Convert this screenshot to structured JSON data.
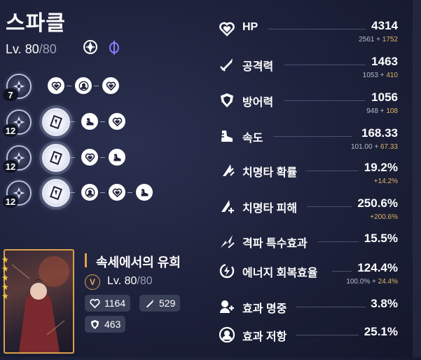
{
  "character": {
    "name": "스파클",
    "level_label": "Lv. ",
    "level": "80",
    "level_sep": "/",
    "level_max": "80",
    "path_icon": "harmony-path-icon",
    "element_icon": "quantum-element-icon"
  },
  "traces": {
    "rows": [
      {
        "badge": "7",
        "nodes": [
          "hp-heart-icon",
          "effect-res-icon",
          "hp-heart-icon"
        ]
      },
      {
        "badge": "12",
        "nodes": [
          "speed-boot-icon",
          "hp-heart-icon"
        ]
      },
      {
        "badge": "12",
        "nodes": [
          "hp-heart-icon",
          "speed-boot-icon"
        ]
      },
      {
        "badge": "12",
        "nodes": [
          "effect-res-icon",
          "hp-heart-icon",
          "speed-boot-icon"
        ]
      }
    ]
  },
  "light_cone": {
    "stars": 5,
    "name": "속세에서의 유희",
    "rank": "V",
    "level_label": "Lv. ",
    "level": "80",
    "level_sep": "/",
    "level_max": "80",
    "hp": "1164",
    "atk": "529",
    "def": "463"
  },
  "stats": [
    {
      "name": "HP",
      "icon": "hp-heart-icon",
      "value": "4314",
      "base": "2561",
      "bonus": "1752"
    },
    {
      "name": "공격력",
      "icon": "attack-sword-icon",
      "value": "1463",
      "base": "1053",
      "bonus": "410"
    },
    {
      "name": "방어력",
      "icon": "defense-shield-icon",
      "value": "1056",
      "base": "948",
      "bonus": "108"
    },
    {
      "name": "속도",
      "icon": "speed-boot-icon",
      "value": "168.33",
      "base": "101.00",
      "bonus": "67.33"
    },
    {
      "name": "치명타 확률",
      "icon": "crit-rate-icon",
      "value": "19.2%",
      "bonus_only": "+14.2%"
    },
    {
      "name": "치명타 피해",
      "icon": "crit-dmg-icon",
      "value": "250.6%",
      "bonus_only": "+200.6%"
    },
    {
      "name": "격파 특수효과",
      "icon": "break-effect-icon",
      "value": "15.5%"
    },
    {
      "name": "에너지 회복효율",
      "icon": "energy-regen-icon",
      "value": "124.4%",
      "base": "100.0%",
      "bonus": "24.4%"
    },
    {
      "name": "효과 명중",
      "icon": "effect-hit-icon",
      "value": "3.8%"
    },
    {
      "name": "효과 저항",
      "icon": "effect-res-icon",
      "value": "25.1%"
    }
  ],
  "colors": {
    "accent_gold": "#e0b56a",
    "background": "#1c2039"
  }
}
